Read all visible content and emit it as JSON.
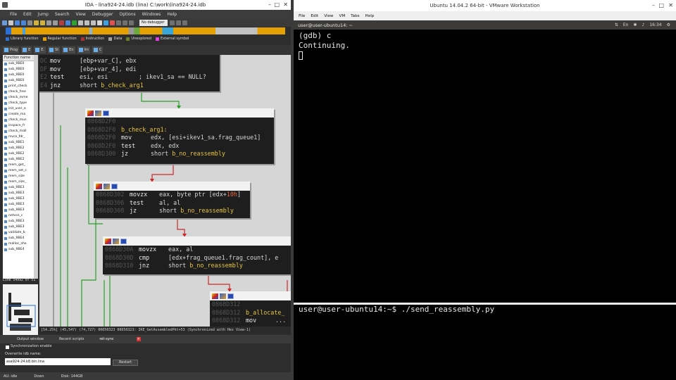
{
  "ida": {
    "title": "IDA - lina924-24.idb (lina) C:\\work\\lina924-24.idb",
    "menu": [
      "File",
      "Edit",
      "Jump",
      "Search",
      "View",
      "Debugger",
      "Options",
      "Windows",
      "Help"
    ],
    "debugger_select": "No debugger",
    "legend": [
      {
        "label": "Library function",
        "color": "#2c6fd6"
      },
      {
        "label": "Regular function",
        "color": "#e3a000"
      },
      {
        "label": "Instruction",
        "color": "#a83232"
      },
      {
        "label": "Data",
        "color": "#a0a0a0"
      },
      {
        "label": "Unexplored",
        "color": "#6a7d28"
      },
      {
        "label": "External symbol",
        "color": "#e040e0"
      }
    ],
    "subtabs": [
      "Prog",
      "E",
      "E.",
      "St",
      "En",
      "Im",
      "C"
    ],
    "functions": {
      "header": "Function name",
      "items": [
        "sub_9BE0",
        "sub_9BE0",
        "sub_9BE0",
        "sub_9BE0",
        "print_check",
        "check_free",
        "check_mme",
        "check_type",
        "init_user_e",
        "create_ma",
        "check_mus",
        "inspace_fr",
        "check_mall",
        "rsvce_fdr_",
        "sub_9BE1",
        "sub_9BE2",
        "sub_9BE2",
        "sub_9BE2",
        "mem_get_",
        "mem_set_c",
        "mem_size",
        "mem_size_",
        "sub_9BE3",
        "sub_9BE3",
        "sub_9BE3",
        "sub_9BE3",
        "sub_9BE3",
        "netvsn_c",
        "sub_9BE3",
        "sub_9BE3",
        "validate_b",
        "sub_9BE4",
        "malloc_sho",
        "sub_9BE4"
      ]
    },
    "line_status": "Line 54992 of 51",
    "blocks": [
      {
        "header": false,
        "lines": [
          {
            "addr": "DC",
            "mn": "mov",
            "op": "[ebp+var_C], ebx",
            "cmt": ""
          },
          {
            "addr": "DF",
            "mn": "mov",
            "op": "[ebp+var_4], edi",
            "cmt": ""
          },
          {
            "addr": "E2",
            "mn": "test",
            "op": "esi, esi",
            "cmt": "; ikev1_sa == NULL?"
          },
          {
            "addr": "E4",
            "mn": "jnz",
            "op": "short ",
            "lbl": "b_check_arg1",
            "cmt": ""
          }
        ]
      },
      {
        "header": true,
        "label_line": "b_check_arg1:",
        "lines": [
          {
            "addr": "0868D2F0",
            "mn": "",
            "op": "",
            "cmt": ""
          },
          {
            "addr": "0868D2F0",
            "mn": "mov",
            "op": "edx, [esi+ikev1_sa.frag_queue1]",
            "cmt": ""
          },
          {
            "addr": "0868D2F0",
            "mn": "test",
            "op": "edx, edx",
            "cmt": ""
          },
          {
            "addr": "0868D300",
            "mn": "jz",
            "op": "short ",
            "lbl": "b_no_reassembly",
            "cmt": ""
          }
        ]
      },
      {
        "header": true,
        "lines": [
          {
            "addr": "0868D302",
            "mn": "movzx",
            "op": "eax, byte ptr [edx+",
            "num": "10h",
            "tail": "]"
          },
          {
            "addr": "0868D306",
            "mn": "test",
            "op": "al, al"
          },
          {
            "addr": "0868D308",
            "mn": "jz",
            "op": "short ",
            "lbl": "b_no_reassembly"
          }
        ]
      },
      {
        "header": true,
        "lines": [
          {
            "addr": "0868D30A",
            "mn": "movzx",
            "op": "eax, al"
          },
          {
            "addr": "0868D30D",
            "mn": "cmp",
            "op": "[edx+frag_queue1.frag_count], e"
          },
          {
            "addr": "0868D310",
            "mn": "jnz",
            "op": "short ",
            "lbl": "b_no_reassembly"
          }
        ]
      },
      {
        "header": true,
        "lines": [
          {
            "addr": "0868D312",
            "mn": "",
            "op": ""
          },
          {
            "addr": "0868D312",
            "mn": "",
            "op": "",
            "lbl": "b_allocate_"
          },
          {
            "addr": "0868D312",
            "mn": "mov",
            "op": "..."
          }
        ]
      }
    ],
    "status_line": "[54.25%] (45,547) (74,727) 00650323 08650323: IKE_GetAssembledPkt+53 (Synchronized with Hex View-1)",
    "bottom_tabs": [
      "Output window",
      "Recent scripts",
      "ret-sync"
    ],
    "sync": {
      "checkbox_label": "Synchronization enable",
      "overwrite_label": "Overwrite idb name:",
      "idb_name": "asa924-24.k8.bin.lina",
      "restart_label": "Restart"
    },
    "status": [
      "AU: idle",
      "Down",
      "Disk: 144GB"
    ]
  },
  "vm": {
    "title": "Ubuntu 14.04.2 64-bit - VMware Workstation",
    "menu": [
      "File",
      "Edit",
      "View",
      "VM",
      "Tabs",
      "Help"
    ],
    "terminal_title": "user@user-ubuntu14: ~",
    "tray": [
      "En",
      "16:34"
    ],
    "term1_lines": [
      "(gdb) c",
      "Continuing."
    ],
    "term2_prompt": "user@user-ubuntu14:~$ ./send_reassembly.py"
  }
}
